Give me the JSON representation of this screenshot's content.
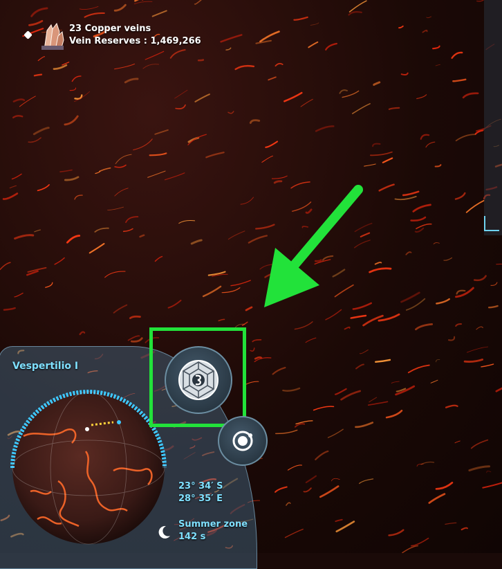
{
  "resource": {
    "line1": "23 Copper veins",
    "line2": "Vein Reserves : 1,469,266",
    "icon": "copper-crystal-icon"
  },
  "planet": {
    "name": "Vespertilio I",
    "latitude": "23°  34′  S",
    "longitude": "28°  35′  E",
    "zone": "Summer zone",
    "time": "142 s"
  },
  "buttons": {
    "dyson": "dyson-sphere-icon",
    "orbit": "orbit-icon"
  },
  "colors": {
    "accent": "#7fe0ff",
    "highlight": "#22e23a",
    "lava": "#ff4a1c"
  }
}
